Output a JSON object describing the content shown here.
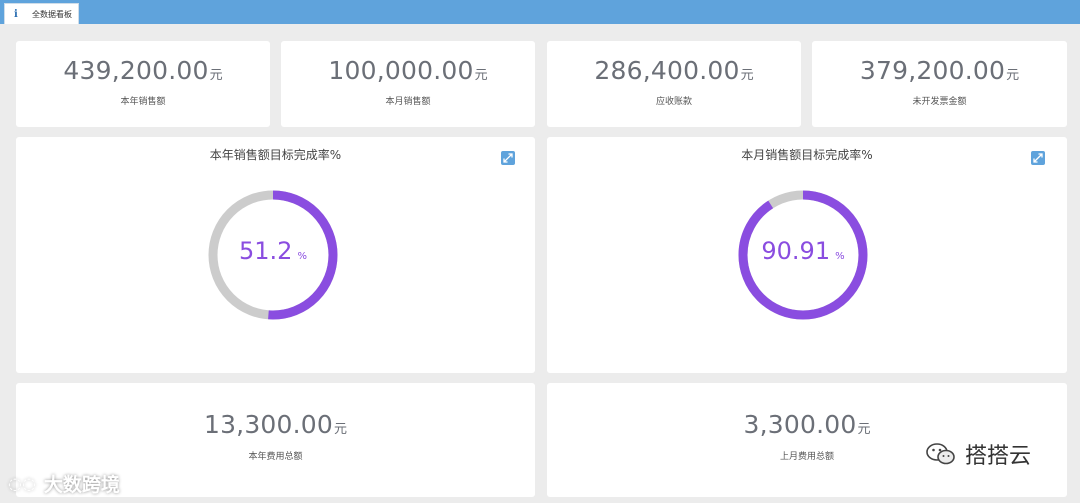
{
  "tab": {
    "icon": "info-icon",
    "label": "全数据看板"
  },
  "kpis": [
    {
      "value": "439,200.00",
      "unit": "元",
      "label": "本年销售额"
    },
    {
      "value": "100,000.00",
      "unit": "元",
      "label": "本月销售额"
    },
    {
      "value": "286,400.00",
      "unit": "元",
      "label": "应收账款"
    },
    {
      "value": "379,200.00",
      "unit": "元",
      "label": "未开发票金额"
    }
  ],
  "gauges": [
    {
      "title": "本年销售额目标完成率%",
      "value": "51.2",
      "suffix": "%",
      "percent": 51.2,
      "icon": "expand-icon"
    },
    {
      "title": "本月销售额目标完成率%",
      "value": "90.91",
      "suffix": "%",
      "percent": 90.91,
      "icon": "expand-icon"
    }
  ],
  "costs": [
    {
      "value": "13,300.00",
      "unit": "元",
      "label": "本年费用总额"
    },
    {
      "value": "3,300.00",
      "unit": "元",
      "label": "上月费用总额"
    }
  ],
  "colors": {
    "topbar": "#5fa3dc",
    "ring_fill": "#8a4de0",
    "ring_track": "#cccccc",
    "value_text": "#6b6f77"
  },
  "watermarks": {
    "left": "大数跨境",
    "right": "搭搭云"
  }
}
